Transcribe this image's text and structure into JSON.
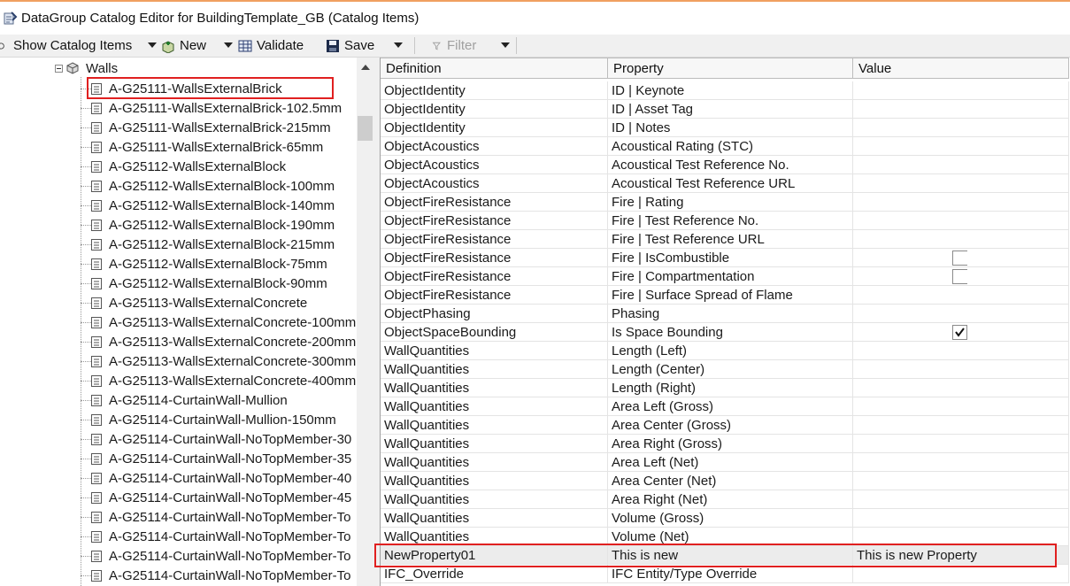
{
  "window": {
    "title": "DataGroup Catalog Editor for BuildingTemplate_GB (Catalog Items)"
  },
  "toolbar": {
    "show_catalog_items": "Show Catalog Items",
    "new_label": "New",
    "validate_label": "Validate",
    "save_label": "Save",
    "filter_label": "Filter"
  },
  "tree": {
    "group_label": "Walls",
    "items": [
      "A-G25111-WallsExternalBrick",
      "A-G25111-WallsExternalBrick-102.5mm",
      "A-G25111-WallsExternalBrick-215mm",
      "A-G25111-WallsExternalBrick-65mm",
      "A-G25112-WallsExternalBlock",
      "A-G25112-WallsExternalBlock-100mm",
      "A-G25112-WallsExternalBlock-140mm",
      "A-G25112-WallsExternalBlock-190mm",
      "A-G25112-WallsExternalBlock-215mm",
      "A-G25112-WallsExternalBlock-75mm",
      "A-G25112-WallsExternalBlock-90mm",
      "A-G25113-WallsExternalConcrete",
      "A-G25113-WallsExternalConcrete-100mm",
      "A-G25113-WallsExternalConcrete-200mm",
      "A-G25113-WallsExternalConcrete-300mm",
      "A-G25113-WallsExternalConcrete-400mm",
      "A-G25114-CurtainWall-Mullion",
      "A-G25114-CurtainWall-Mullion-150mm",
      "A-G25114-CurtainWall-NoTopMember-30",
      "A-G25114-CurtainWall-NoTopMember-35",
      "A-G25114-CurtainWall-NoTopMember-40",
      "A-G25114-CurtainWall-NoTopMember-45",
      "A-G25114-CurtainWall-NoTopMember-To",
      "A-G25114-CurtainWall-NoTopMember-To",
      "A-G25114-CurtainWall-NoTopMember-To",
      "A-G25114-CurtainWall-NoTopMember-To"
    ]
  },
  "grid": {
    "columns": [
      "Definition",
      "Property",
      "Value"
    ],
    "rows": [
      {
        "definition": "ObjectIdentity",
        "property": "ID | Keynote",
        "value": ""
      },
      {
        "definition": "ObjectIdentity",
        "property": "ID | Asset Tag",
        "value": ""
      },
      {
        "definition": "ObjectIdentity",
        "property": "ID | Notes",
        "value": ""
      },
      {
        "definition": "ObjectAcoustics",
        "property": "Acoustical Rating (STC)",
        "value": ""
      },
      {
        "definition": "ObjectAcoustics",
        "property": "Acoustical Test Reference No.",
        "value": ""
      },
      {
        "definition": "ObjectAcoustics",
        "property": "Acoustical Test Reference URL",
        "value": ""
      },
      {
        "definition": "ObjectFireResistance",
        "property": "Fire | Rating",
        "value": ""
      },
      {
        "definition": "ObjectFireResistance",
        "property": "Fire | Test Reference No.",
        "value": ""
      },
      {
        "definition": "ObjectFireResistance",
        "property": "Fire | Test Reference URL",
        "value": ""
      },
      {
        "definition": "ObjectFireResistance",
        "property": "Fire | IsCombustible",
        "value": "",
        "checkbox": "unchecked"
      },
      {
        "definition": "ObjectFireResistance",
        "property": "Fire | Compartmentation",
        "value": "",
        "checkbox": "unchecked"
      },
      {
        "definition": "ObjectFireResistance",
        "property": "Fire | Surface Spread of Flame",
        "value": ""
      },
      {
        "definition": "ObjectPhasing",
        "property": "Phasing",
        "value": ""
      },
      {
        "definition": "ObjectSpaceBounding",
        "property": "Is Space Bounding",
        "value": "",
        "checkbox": "checked"
      },
      {
        "definition": "WallQuantities",
        "property": "Length (Left)",
        "value": ""
      },
      {
        "definition": "WallQuantities",
        "property": "Length (Center)",
        "value": ""
      },
      {
        "definition": "WallQuantities",
        "property": "Length (Right)",
        "value": ""
      },
      {
        "definition": "WallQuantities",
        "property": "Area Left (Gross)",
        "value": ""
      },
      {
        "definition": "WallQuantities",
        "property": "Area Center (Gross)",
        "value": ""
      },
      {
        "definition": "WallQuantities",
        "property": "Area Right (Gross)",
        "value": ""
      },
      {
        "definition": "WallQuantities",
        "property": "Area Left (Net)",
        "value": ""
      },
      {
        "definition": "WallQuantities",
        "property": "Area Center (Net)",
        "value": ""
      },
      {
        "definition": "WallQuantities",
        "property": "Area Right (Net)",
        "value": ""
      },
      {
        "definition": "WallQuantities",
        "property": "Volume (Gross)",
        "value": ""
      },
      {
        "definition": "WallQuantities",
        "property": "Volume (Net)",
        "value": ""
      },
      {
        "definition": "NewProperty01",
        "property": "This is new",
        "value": "This is new Property"
      },
      {
        "definition": "IFC_Override",
        "property": "IFC Entity/Type Override",
        "value": ""
      }
    ]
  },
  "colors": {
    "highlight_box": "#e02020",
    "title_accent": "#f0a060"
  }
}
